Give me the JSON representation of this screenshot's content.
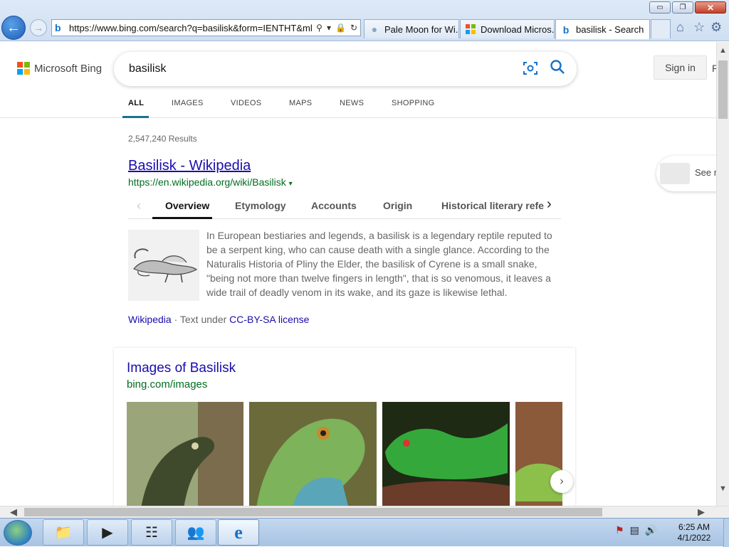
{
  "browser": {
    "address_url": "https://www.bing.com/search?q=basilisk&form=IENTHT&mkt=",
    "tabs": [
      {
        "title": "Pale Moon for Wi..."
      },
      {
        "title": "Download Micros..."
      },
      {
        "title": "basilisk - Search"
      }
    ],
    "window_controls": {
      "minimize": "▭",
      "restore": "❐",
      "close": "✕"
    }
  },
  "bing": {
    "logo_text": "Microsoft Bing",
    "logo_colors": [
      "#f25022",
      "#7fba00",
      "#00a4ef",
      "#ffb900"
    ],
    "query": "basilisk",
    "sign_in": "Sign in",
    "rewards_initial": "R",
    "scopes": [
      "ALL",
      "IMAGES",
      "VIDEOS",
      "MAPS",
      "NEWS",
      "SHOPPING"
    ],
    "active_scope": "ALL",
    "result_count": "2,547,240 Results",
    "see_more_label": "See m"
  },
  "result1": {
    "title": "Basilisk - Wikipedia",
    "url": "https://en.wikipedia.org/wiki/Basilisk",
    "tabs": [
      "Overview",
      "Etymology",
      "Accounts",
      "Origin",
      "Historical literary refe"
    ],
    "active_tab": "Overview",
    "description": "In European bestiaries and legends, a basilisk is a legendary reptile reputed to be a serpent king, who can cause death with a single glance. According to the Naturalis Historia of Pliny the Elder, the basilisk of Cyrene is a small snake, \"being not more than twelve fingers in length\", that is so venomous, it leaves a wide trail of deadly venom in its wake, and its gaze is likewise lethal.",
    "source": "Wikipedia",
    "license_prefix": "· Text under",
    "license": "CC-BY-SA license"
  },
  "images": {
    "title": "Images of Basilisk",
    "source": "bing.com/images"
  },
  "taskbar": {
    "time": "6:25 AM",
    "date": "4/1/2022"
  }
}
